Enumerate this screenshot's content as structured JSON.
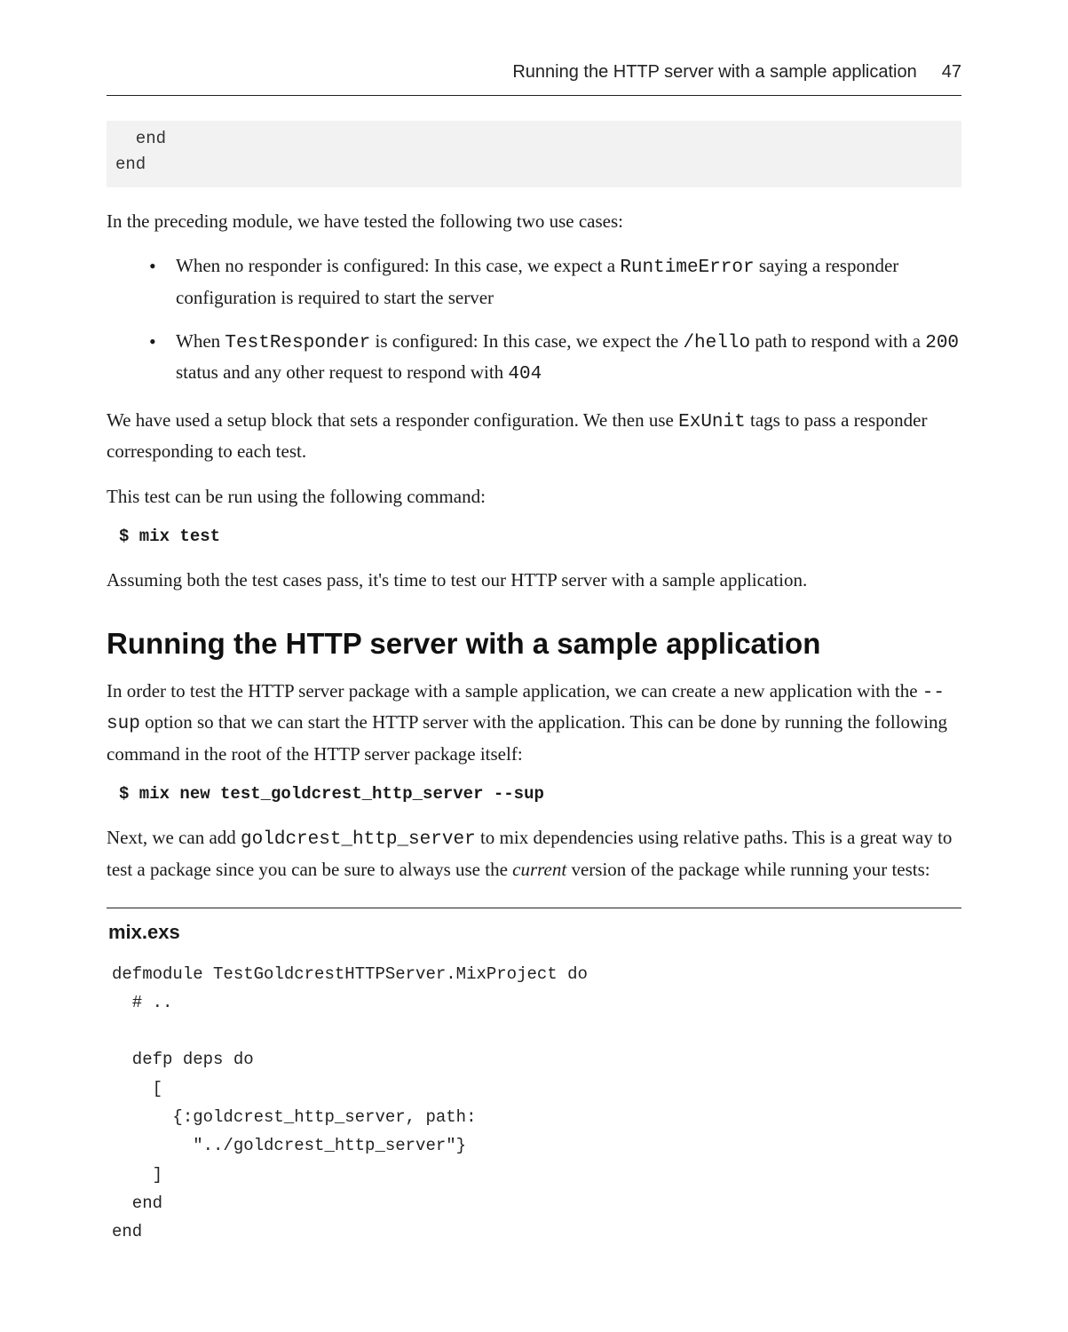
{
  "header": {
    "running_title": "Running the HTTP server with a sample application",
    "page_number": "47"
  },
  "code_top": "  end\nend",
  "para1_a": "In the preceding module, we have tested the following two use cases:",
  "bullets": [
    {
      "pre": "When no responder is configured: In this case, we expect a ",
      "code1": "RuntimeError",
      "post": " saying a responder configuration is required to start the server"
    },
    {
      "pre": "When ",
      "code1": "TestResponder",
      "mid1": " is configured: In this case, we expect the ",
      "code2": "/hello",
      "mid2": " path to respond with a ",
      "code3": "200",
      "mid3": " status and any other request to respond with ",
      "code4": "404"
    }
  ],
  "para2_a": "We have used a setup block that sets a responder configuration. We then use ",
  "para2_code": "ExUnit",
  "para2_b": " tags to pass a responder corresponding to each test.",
  "para3": "This test can be run using the following command:",
  "cmd1": "$ mix test",
  "para4": "Assuming both the test cases pass, it's time to test our HTTP server with a sample application.",
  "section_heading": "Running the HTTP server with a sample application",
  "para5_a": "In order to test the HTTP server package with a sample application, we can create a new application with the ",
  "para5_code": "--sup",
  "para5_b": " option so that we can start the HTTP server with the application. This can be done by running the following command in the root of the HTTP server package itself:",
  "cmd2": "$ mix new test_goldcrest_http_server --sup",
  "para6_a": "Next, we can add ",
  "para6_code": "goldcrest_http_server",
  "para6_b": " to mix dependencies using relative paths. This is a great way to test a package since you can be sure to always use the ",
  "para6_em": "current",
  "para6_c": " version of the package while running your tests:",
  "file_label": "mix.exs",
  "code_bottom": "defmodule TestGoldcrestHTTPServer.MixProject do\n  # ..\n\n  defp deps do\n    [\n      {:goldcrest_http_server, path:\n        \"../goldcrest_http_server\"}\n    ]\n  end\nend"
}
